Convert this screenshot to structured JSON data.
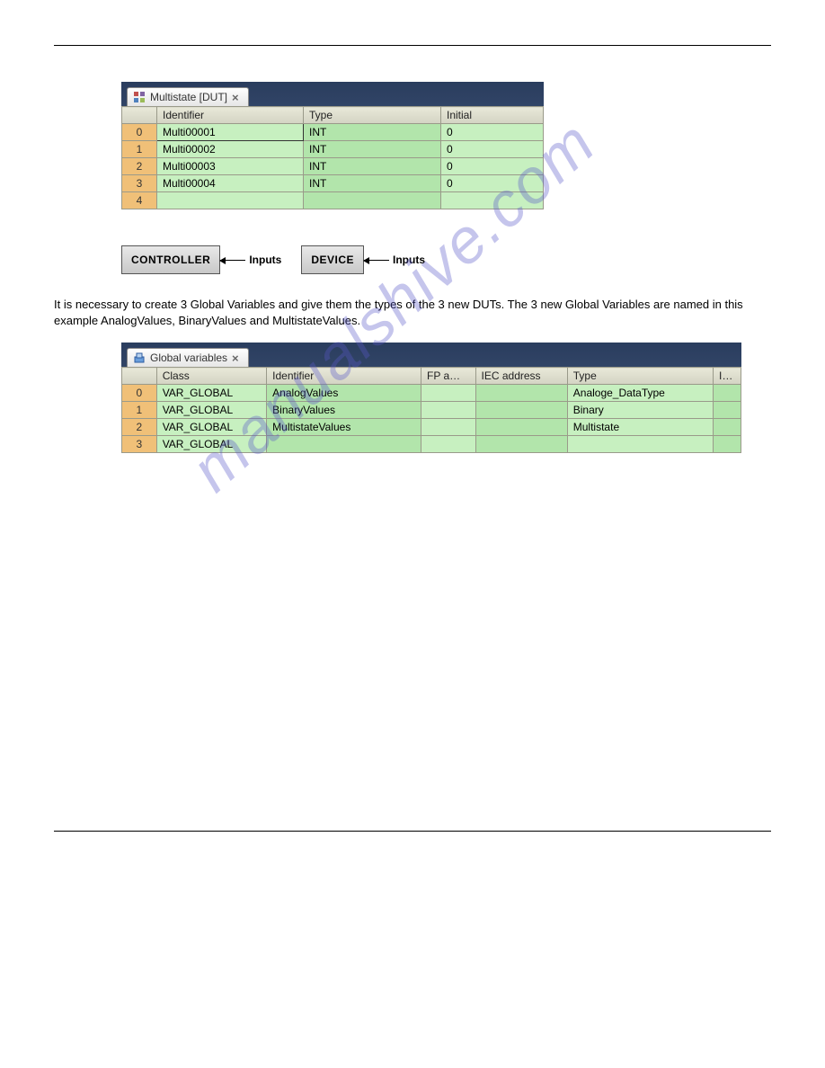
{
  "watermark": "manualshive.com",
  "panel1": {
    "tab_title": "Multistate [DUT]",
    "tab_close": "×",
    "headers": [
      "Identifier",
      "Type",
      "Initial"
    ],
    "rows": [
      {
        "n": "0",
        "identifier": "Multi00001",
        "type": "INT",
        "initial": "0"
      },
      {
        "n": "1",
        "identifier": "Multi00002",
        "type": "INT",
        "initial": "0"
      },
      {
        "n": "2",
        "identifier": "Multi00003",
        "type": "INT",
        "initial": "0"
      },
      {
        "n": "3",
        "identifier": "Multi00004",
        "type": "INT",
        "initial": "0"
      },
      {
        "n": "4",
        "identifier": "",
        "type": "",
        "initial": ""
      }
    ]
  },
  "diagram": {
    "controller": "CONTROLLER",
    "device": "DEVICE",
    "inputs_label_1": "Inputs",
    "inputs_label_2": "Inputs"
  },
  "section3": {
    "paragraph": "It is necessary to create 3 Global Variables and give them the types of the 3 new DUTs. The 3 new Global Variables are named in this example AnalogValues, BinaryValues and MultistateValues."
  },
  "panel2": {
    "tab_title": "Global variables",
    "tab_close": "×",
    "headers": [
      "Class",
      "Identifier",
      "FP a…",
      "IEC address",
      "Type",
      "I…"
    ],
    "rows": [
      {
        "n": "0",
        "class": "VAR_GLOBAL",
        "identifier": "AnalogValues",
        "fpa": "",
        "iec": "",
        "type": "Analoge_DataType"
      },
      {
        "n": "1",
        "class": "VAR_GLOBAL",
        "identifier": "BinaryValues",
        "fpa": "",
        "iec": "",
        "type": "Binary"
      },
      {
        "n": "2",
        "class": "VAR_GLOBAL",
        "identifier": "MultistateValues",
        "fpa": "",
        "iec": "",
        "type": "Multistate"
      },
      {
        "n": "3",
        "class": "VAR_GLOBAL",
        "identifier": "",
        "fpa": "",
        "iec": "",
        "type": ""
      }
    ]
  }
}
